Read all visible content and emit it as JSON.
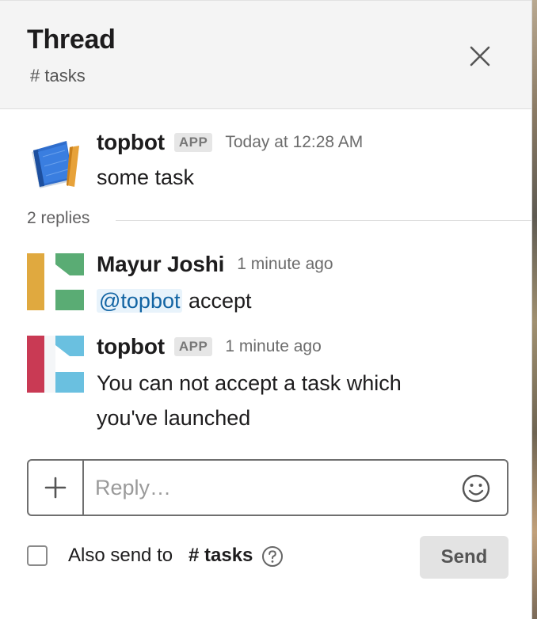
{
  "header": {
    "title": "Thread",
    "channel": "# tasks"
  },
  "messages": [
    {
      "author": "topbot",
      "badge": "APP",
      "timestamp": "Today at 12:28 AM",
      "text": "some task",
      "avatar_icon": "book-ruler-icon"
    },
    {
      "author": "Mayur Joshi",
      "timestamp": "1 minute ago",
      "mention": "@topbot",
      "text": "accept",
      "avatar_colors": [
        "#e0a93f",
        "#5aac74"
      ]
    },
    {
      "author": "topbot",
      "badge": "APP",
      "timestamp": "1 minute ago",
      "text_line1": "You can not accept a task which",
      "text_line2": "you've launched",
      "avatar_colors": [
        "#c93a54",
        "#6ac0e0"
      ]
    }
  ],
  "replies_label": "2 replies",
  "composer": {
    "placeholder": "Reply…",
    "value": ""
  },
  "footer": {
    "also_send_label": "Also send to",
    "channel_label": "# tasks",
    "send_label": "Send"
  },
  "icons": {
    "close": "close-icon",
    "add": "plus-icon",
    "emoji": "emoji-icon",
    "help": "help-icon"
  },
  "colors": {
    "mention_text": "#1264a3",
    "mention_bg": "#e8f3fb",
    "header_bg": "#f4f4f4"
  }
}
